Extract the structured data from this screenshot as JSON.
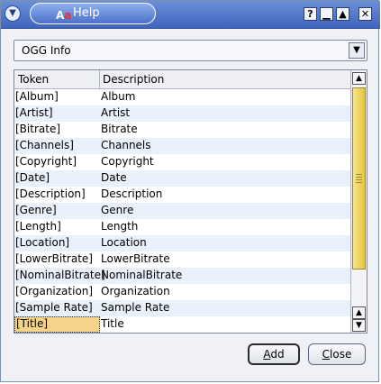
{
  "window": {
    "title": "Help"
  },
  "combo": {
    "value": "OGG Info"
  },
  "table": {
    "headers": [
      "Token",
      "Description"
    ],
    "rows": [
      [
        "[Album]",
        "Album"
      ],
      [
        "[Artist]",
        "Artist"
      ],
      [
        "[Bitrate]",
        "Bitrate"
      ],
      [
        "[Channels]",
        "Channels"
      ],
      [
        "[Copyright]",
        "Copyright"
      ],
      [
        "[Date]",
        "Date"
      ],
      [
        "[Description]",
        "Description"
      ],
      [
        "[Genre]",
        "Genre"
      ],
      [
        "[Length]",
        "Length"
      ],
      [
        "[Location]",
        "Location"
      ],
      [
        "[LowerBitrate]",
        "LowerBitrate"
      ],
      [
        "[NominalBitrate]",
        "NominalBitrate"
      ],
      [
        "[Organization]",
        "Organization"
      ],
      [
        "[Sample Rate]",
        "Sample Rate"
      ],
      [
        "[Title]",
        "Title"
      ]
    ],
    "selected_row": 14
  },
  "buttons": {
    "add": {
      "mnemonic": "A",
      "rest": "dd"
    },
    "close": {
      "mnemonic": "C",
      "rest": "lose"
    }
  },
  "icons": {
    "menu": "menu-arrow-icon",
    "help": "question-icon",
    "minimize": "minimize-icon",
    "maximize": "maximize-icon",
    "close": "close-icon"
  }
}
